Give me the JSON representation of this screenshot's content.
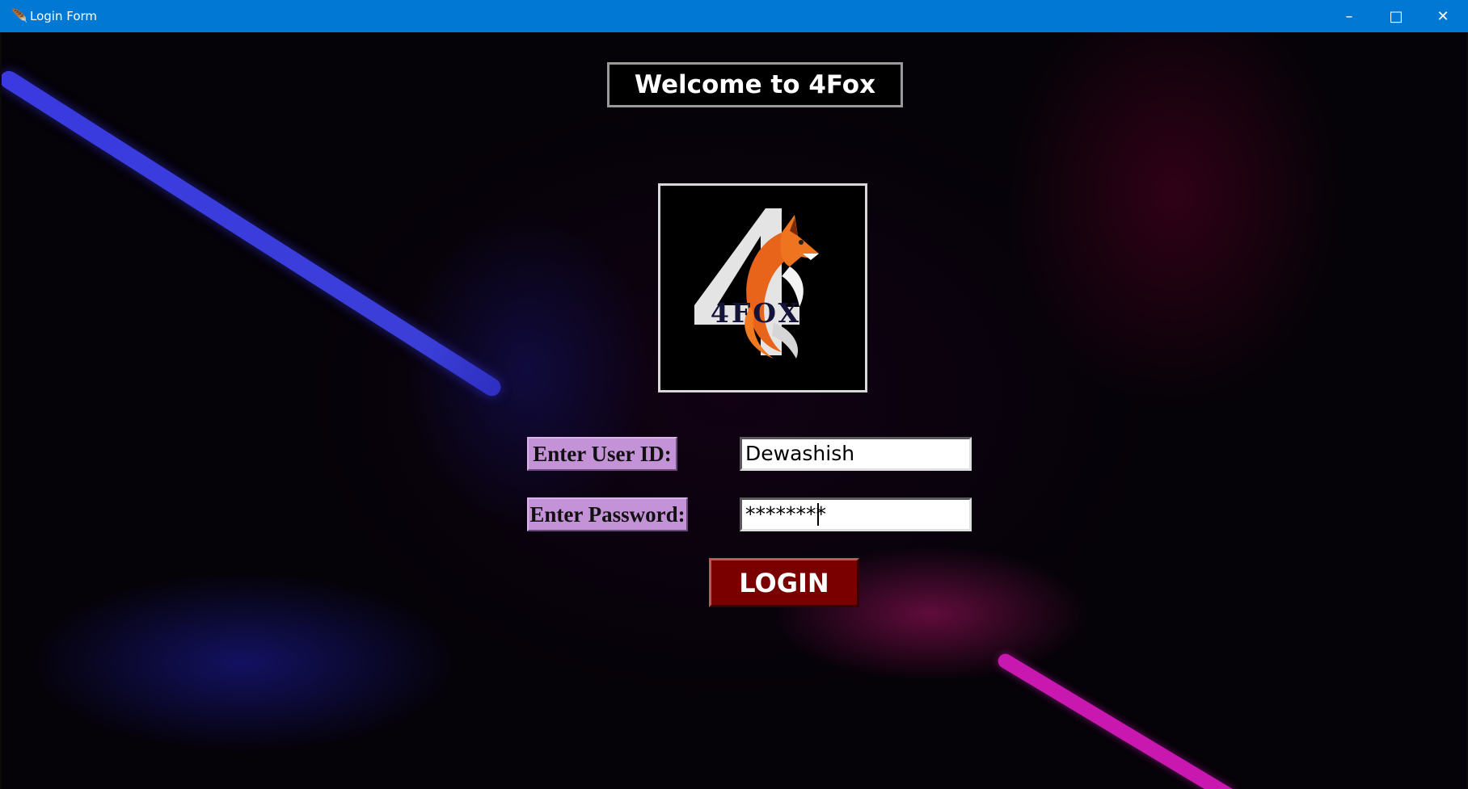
{
  "window": {
    "title": "Login Form",
    "controls": {
      "minimize": "–",
      "maximize": "□",
      "close": "✕"
    }
  },
  "header": {
    "welcome": "Welcome to 4Fox"
  },
  "logo": {
    "text": "4FOX",
    "icon": "fox-logo"
  },
  "form": {
    "user_label": "Enter User ID:",
    "user_value": "Dewashish",
    "password_label": "Enter Password:",
    "password_value": "********",
    "login_label": "LOGIN"
  },
  "colors": {
    "titlebar": "#0078d4",
    "label_bg": "#c492d6",
    "button_bg": "#7a0000",
    "streak_blue": "#3a3ae0",
    "streak_pink": "#c818b0"
  }
}
